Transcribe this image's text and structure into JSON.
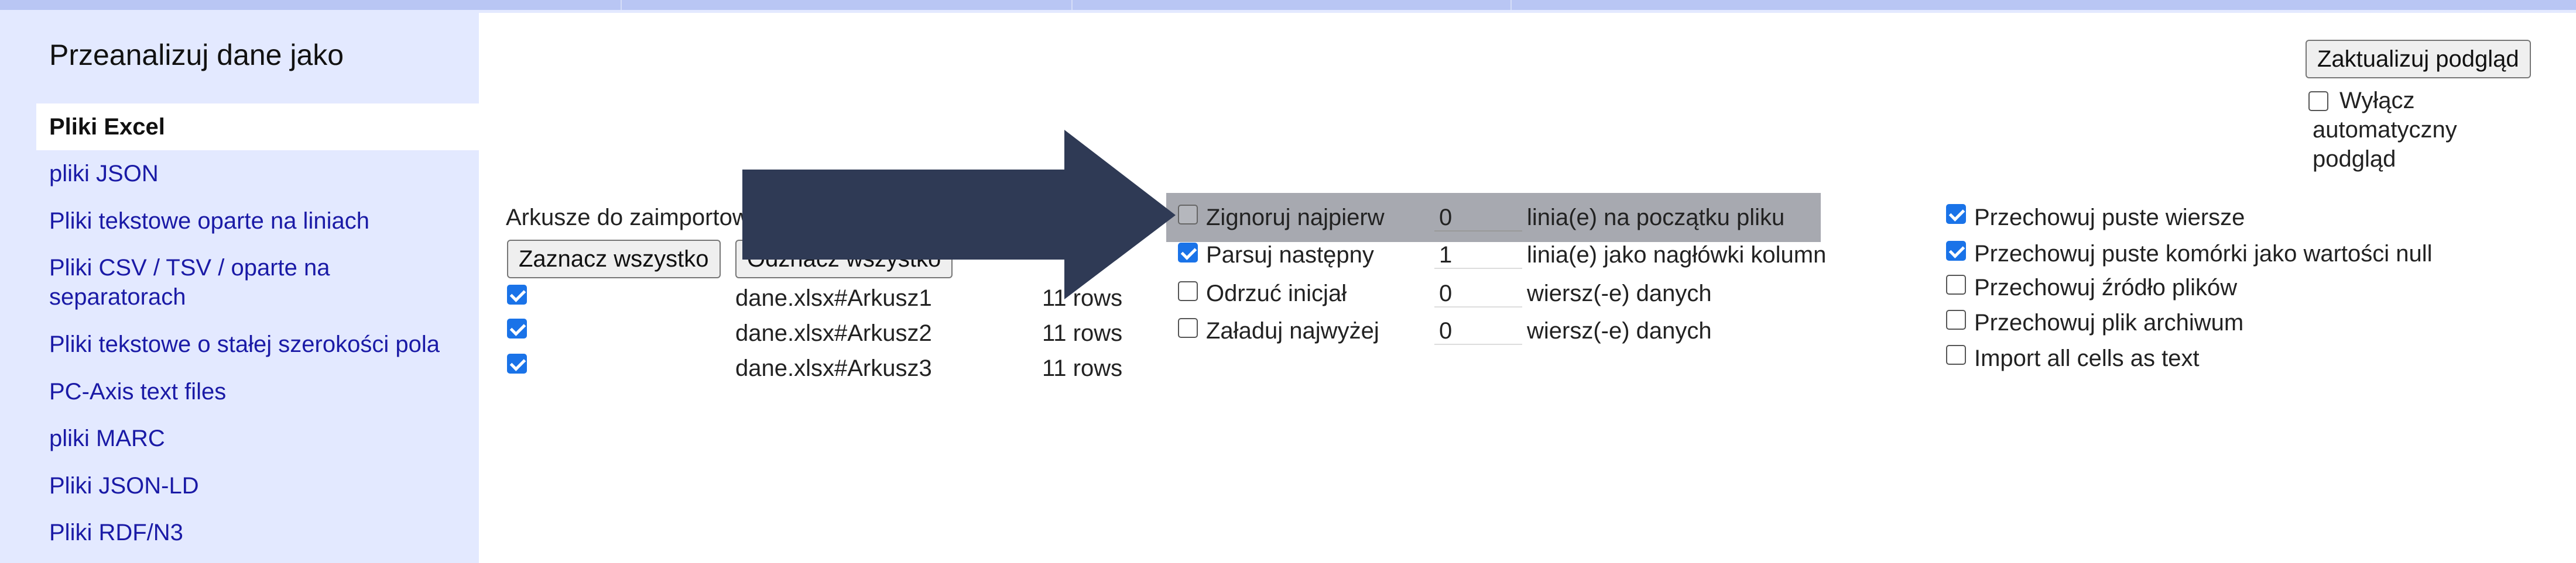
{
  "sidebar": {
    "heading": "Przeanalizuj dane jako",
    "items": [
      {
        "label": "Pliki Excel",
        "selected": true
      },
      {
        "label": "pliki JSON"
      },
      {
        "label": "Pliki tekstowe oparte na liniach"
      },
      {
        "label": "Pliki CSV / TSV / oparte na separatorach"
      },
      {
        "label": "Pliki tekstowe o stałej szerokości pola"
      },
      {
        "label": "PC-Axis text files"
      },
      {
        "label": "pliki MARC"
      },
      {
        "label": "Pliki JSON-LD"
      },
      {
        "label": "Pliki RDF/N3"
      }
    ]
  },
  "sheets": {
    "label": "Arkusze do zaimportowania",
    "select_all": "Zaznacz wszystko",
    "deselect_all": "Odznacz wszystko",
    "rows": [
      {
        "checked": true,
        "name": "dane.xlsx#Arkusz1",
        "count": "11 rows"
      },
      {
        "checked": true,
        "name": "dane.xlsx#Arkusz2",
        "count": "11 rows"
      },
      {
        "checked": true,
        "name": "dane.xlsx#Arkusz3",
        "count": "11 rows"
      }
    ]
  },
  "options": [
    {
      "checked": false,
      "label": "Zignoruj najpierw",
      "value": "0",
      "suffix": "linia(e) na początku pliku",
      "highlighted": true
    },
    {
      "checked": true,
      "label": "Parsuj następny",
      "value": "1",
      "suffix": "linia(e) jako nagłówki kolumn"
    },
    {
      "checked": false,
      "label": "Odrzuć inicjał",
      "value": "0",
      "suffix": "wiersz(-e) danych"
    },
    {
      "checked": false,
      "label": "Załaduj najwyżej",
      "value": "0",
      "suffix": "wiersz(-e) danych"
    }
  ],
  "right_options": [
    {
      "checked": true,
      "label": "Przechowuj puste wiersze"
    },
    {
      "checked": true,
      "label": "Przechowuj puste komórki jako wartości null"
    },
    {
      "checked": false,
      "label": "Przechowuj źródło plików"
    },
    {
      "checked": false,
      "label": "Przechowuj plik archiwum"
    },
    {
      "checked": false,
      "label": "Import all cells as text"
    }
  ],
  "preview": {
    "update_button": "Zaktualizuj podgląd",
    "auto_checked": false,
    "auto_line1": "Wyłącz",
    "auto_line2": "automatyczny",
    "auto_line3": "podgląd"
  },
  "colors": {
    "sidebar_bg": "#e3e9ff",
    "link": "#1a1aa6",
    "checkbox": "#1a73e8",
    "arrow": "#2f3a55",
    "highlight": "#a7a9b0"
  }
}
